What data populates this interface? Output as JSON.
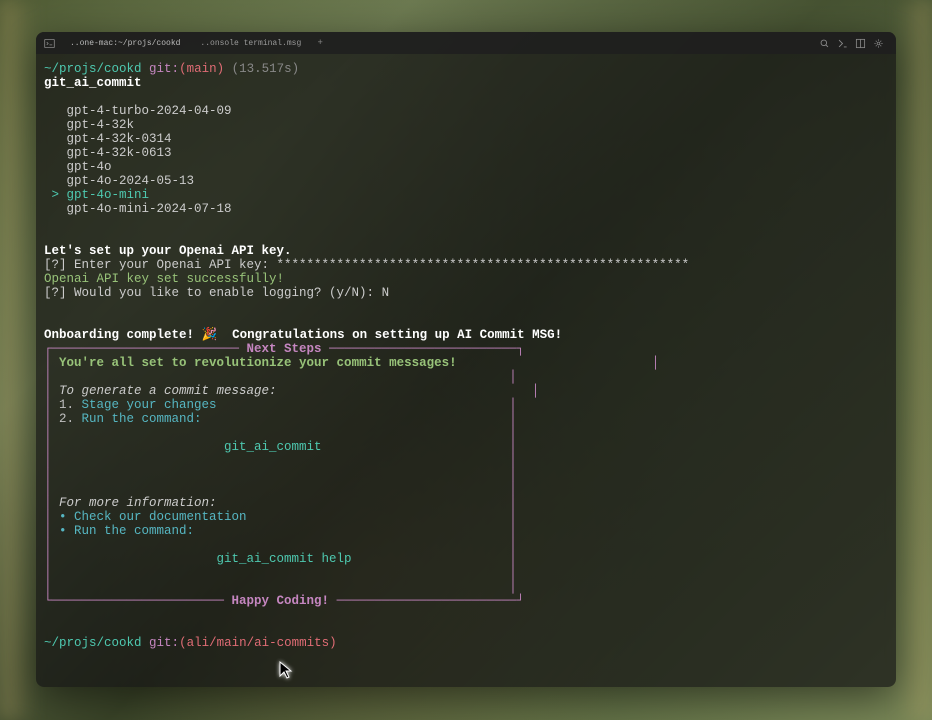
{
  "tabBar": {
    "tab1": "..one-mac:~/projs/cookd",
    "tab2": "..onsole terminal.msg",
    "addIcon": "+"
  },
  "prompt1": {
    "path": "~/projs/cookd",
    "git": "git:",
    "branch": "(main)",
    "time": "(13.517s)"
  },
  "command": "git_ai_commit",
  "models": {
    "m0": "gpt-4-turbo-2024-04-09",
    "m1": "gpt-4-32k",
    "m2": "gpt-4-32k-0314",
    "m3": "gpt-4-32k-0613",
    "m4": "gpt-4o",
    "m5": "gpt-4o-2024-05-13",
    "selected": "gpt-4o-mini",
    "m7": "gpt-4o-mini-2024-07-18"
  },
  "setup": {
    "line1": "Let's set up your Openai API key.",
    "line2_q": "[?] Enter your Openai API key: ",
    "line2_mask": "*******************************************************",
    "line3": "Openai API key set successfully!",
    "line4_q": "[?] Would you like to enable logging? (y/N): ",
    "line4_ans": "N"
  },
  "complete": {
    "text1": "Onboarding complete! ",
    "emoji": "🎉",
    "text2": "  Congratulations on setting up AI Commit MSG!"
  },
  "box": {
    "title": "Next Steps",
    "revolutionize": "You're all set to revolutionize your commit messages!",
    "generate_label": "To generate a commit message:",
    "step1_num": "1. ",
    "step1": "Stage your changes",
    "step2_num": "2. ",
    "step2": "Run the command:",
    "cmd1": "git_ai_commit",
    "info_label": "For more information:",
    "bullet1": "Check our documentation",
    "bullet2": "Run the command:",
    "cmd2": "git_ai_commit help",
    "happy": "Happy Coding!"
  },
  "prompt2": {
    "path": "~/projs/cookd",
    "git": "git:",
    "branch": "(ali/main/ai-commits)"
  }
}
